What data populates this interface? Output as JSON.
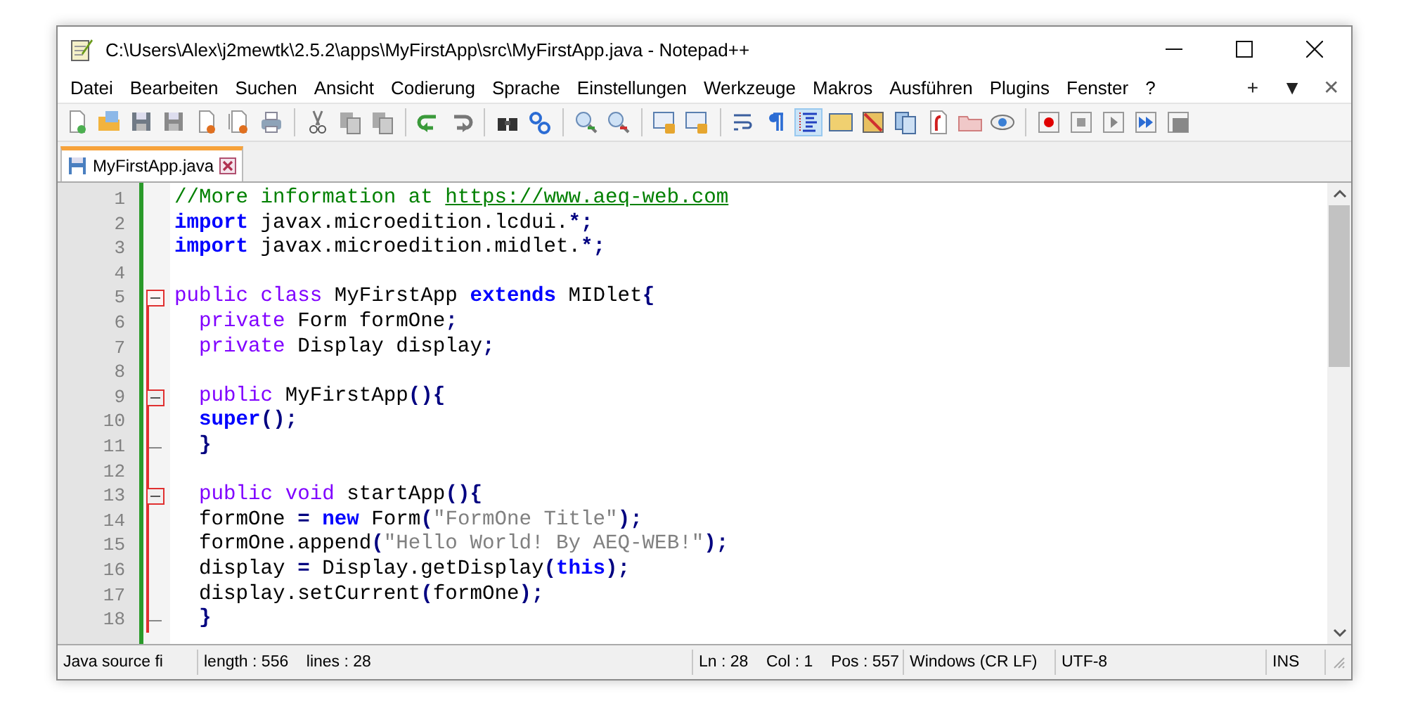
{
  "window": {
    "title": "C:\\Users\\Alex\\j2mewtk\\2.5.2\\apps\\MyFirstApp\\src\\MyFirstApp.java - Notepad++"
  },
  "menu": [
    "Datei",
    "Bearbeiten",
    "Suchen",
    "Ansicht",
    "Codierung",
    "Sprache",
    "Einstellungen",
    "Werkzeuge",
    "Makros",
    "Ausführen",
    "Plugins",
    "Fenster",
    "?"
  ],
  "menu_controls": [
    "+",
    "▼",
    "✕"
  ],
  "toolbar": [
    [
      {
        "selected": false
      },
      {
        "selected": false
      },
      {
        "selected": false
      },
      {
        "selected": false
      },
      {
        "selected": false
      },
      {
        "selected": false
      },
      {
        "selected": false
      }
    ],
    [
      {
        "selected": false
      },
      {
        "selected": false
      },
      {
        "selected": false
      }
    ],
    [
      {
        "selected": false
      },
      {
        "selected": false
      }
    ],
    [
      {
        "selected": false
      },
      {
        "selected": false
      }
    ],
    [
      {
        "selected": false
      },
      {
        "selected": false
      }
    ],
    [
      {
        "selected": false
      },
      {
        "selected": false
      }
    ],
    [
      {
        "selected": false
      },
      {
        "selected": false
      },
      {
        "selected": true
      },
      {
        "selected": false
      },
      {
        "selected": false
      },
      {
        "selected": false
      },
      {
        "selected": false
      },
      {
        "selected": false
      },
      {
        "selected": false
      }
    ],
    [
      {
        "selected": false
      },
      {
        "selected": false
      },
      {
        "selected": false
      },
      {
        "selected": false
      },
      {
        "selected": false
      }
    ]
  ],
  "tabs": [
    {
      "label": "MyFirstApp.java",
      "selected": true
    }
  ],
  "editor": {
    "lines": [
      {
        "number": "1",
        "fold_start": false,
        "in_fold": false,
        "fold_end": false,
        "tokens": [
          {
            "kind": "comment",
            "text": "//More information at "
          },
          {
            "kind": "link",
            "text": "https://www.aeq-web.com"
          }
        ]
      },
      {
        "number": "2",
        "fold_start": false,
        "in_fold": false,
        "fold_end": false,
        "tokens": [
          {
            "kind": "keyword2",
            "text": "import"
          },
          {
            "kind": "plain",
            "text": " javax.microedition.lcdui."
          },
          {
            "kind": "op",
            "text": "*;"
          }
        ]
      },
      {
        "number": "3",
        "fold_start": false,
        "in_fold": false,
        "fold_end": false,
        "tokens": [
          {
            "kind": "keyword2",
            "text": "import"
          },
          {
            "kind": "plain",
            "text": " javax.microedition.midlet."
          },
          {
            "kind": "op",
            "text": "*;"
          }
        ]
      },
      {
        "number": "4",
        "fold_start": false,
        "in_fold": false,
        "fold_end": false
      },
      {
        "number": "5",
        "fold_start": true,
        "in_fold": false,
        "fold_end": false,
        "tokens": [
          {
            "kind": "keyword",
            "text": "public class"
          },
          {
            "kind": "plain",
            "text": " MyFirstApp "
          },
          {
            "kind": "keyword2",
            "text": "extends"
          },
          {
            "kind": "plain",
            "text": " MIDlet"
          },
          {
            "kind": "op",
            "text": "{"
          }
        ]
      },
      {
        "number": "6",
        "fold_start": false,
        "in_fold": true,
        "fold_end": false,
        "tokens": [
          {
            "kind": "keyword",
            "text": "  private"
          },
          {
            "kind": "plain",
            "text": " Form formOne"
          },
          {
            "kind": "op",
            "text": ";"
          }
        ]
      },
      {
        "number": "7",
        "fold_start": false,
        "in_fold": true,
        "fold_end": false,
        "tokens": [
          {
            "kind": "keyword",
            "text": "  private"
          },
          {
            "kind": "plain",
            "text": " Display display"
          },
          {
            "kind": "op",
            "text": ";"
          }
        ]
      },
      {
        "number": "8",
        "fold_start": false,
        "in_fold": true,
        "fold_end": false
      },
      {
        "number": "9",
        "fold_start": true,
        "in_fold": true,
        "fold_end": false,
        "tokens": [
          {
            "kind": "keyword",
            "text": "  public"
          },
          {
            "kind": "plain",
            "text": " MyFirstApp"
          },
          {
            "kind": "op",
            "text": "(){"
          }
        ]
      },
      {
        "number": "10",
        "fold_start": false,
        "in_fold": true,
        "fold_end": false,
        "tokens": [
          {
            "kind": "keyword2",
            "text": "  super"
          },
          {
            "kind": "op",
            "text": "();"
          }
        ]
      },
      {
        "number": "11",
        "fold_start": false,
        "in_fold": true,
        "fold_end": true,
        "tokens": [
          {
            "kind": "op",
            "text": "  }"
          }
        ]
      },
      {
        "number": "12",
        "fold_start": false,
        "in_fold": true,
        "fold_end": false
      },
      {
        "number": "13",
        "fold_start": true,
        "in_fold": true,
        "fold_end": false,
        "tokens": [
          {
            "kind": "keyword",
            "text": "  public void"
          },
          {
            "kind": "plain",
            "text": " startApp"
          },
          {
            "kind": "op",
            "text": "(){"
          }
        ]
      },
      {
        "number": "14",
        "fold_start": false,
        "in_fold": true,
        "fold_end": false,
        "tokens": [
          {
            "kind": "plain",
            "text": "  formOne "
          },
          {
            "kind": "op",
            "text": "="
          },
          {
            "kind": "keyword2",
            "text": " new"
          },
          {
            "kind": "plain",
            "text": " Form"
          },
          {
            "kind": "op",
            "text": "("
          },
          {
            "kind": "string",
            "text": "\"FormOne Title\""
          },
          {
            "kind": "op",
            "text": ");"
          }
        ]
      },
      {
        "number": "15",
        "fold_start": false,
        "in_fold": true,
        "fold_end": false,
        "tokens": [
          {
            "kind": "plain",
            "text": "  formOne.append"
          },
          {
            "kind": "op",
            "text": "("
          },
          {
            "kind": "string",
            "text": "\"Hello World! By AEQ-WEB!\""
          },
          {
            "kind": "op",
            "text": ");"
          }
        ]
      },
      {
        "number": "16",
        "fold_start": false,
        "in_fold": true,
        "fold_end": false,
        "tokens": [
          {
            "kind": "plain",
            "text": "  display "
          },
          {
            "kind": "op",
            "text": "="
          },
          {
            "kind": "plain",
            "text": " Display.getDisplay"
          },
          {
            "kind": "op",
            "text": "("
          },
          {
            "kind": "keyword2",
            "text": "this"
          },
          {
            "kind": "op",
            "text": ");"
          }
        ]
      },
      {
        "number": "17",
        "fold_start": false,
        "in_fold": true,
        "fold_end": false,
        "tokens": [
          {
            "kind": "plain",
            "text": "  display.setCurrent"
          },
          {
            "kind": "op",
            "text": "("
          },
          {
            "kind": "plain",
            "text": "formOne"
          },
          {
            "kind": "op",
            "text": ");"
          }
        ]
      },
      {
        "number": "18",
        "fold_start": false,
        "in_fold": true,
        "fold_end": true,
        "tokens": [
          {
            "kind": "op",
            "text": "  }"
          }
        ]
      }
    ]
  },
  "status_bar": [
    "Java source fi",
    "length : 556    lines : 28",
    "Ln : 28    Col : 1    Pos : 557",
    "Windows (CR LF)",
    "UTF-8",
    "INS"
  ]
}
